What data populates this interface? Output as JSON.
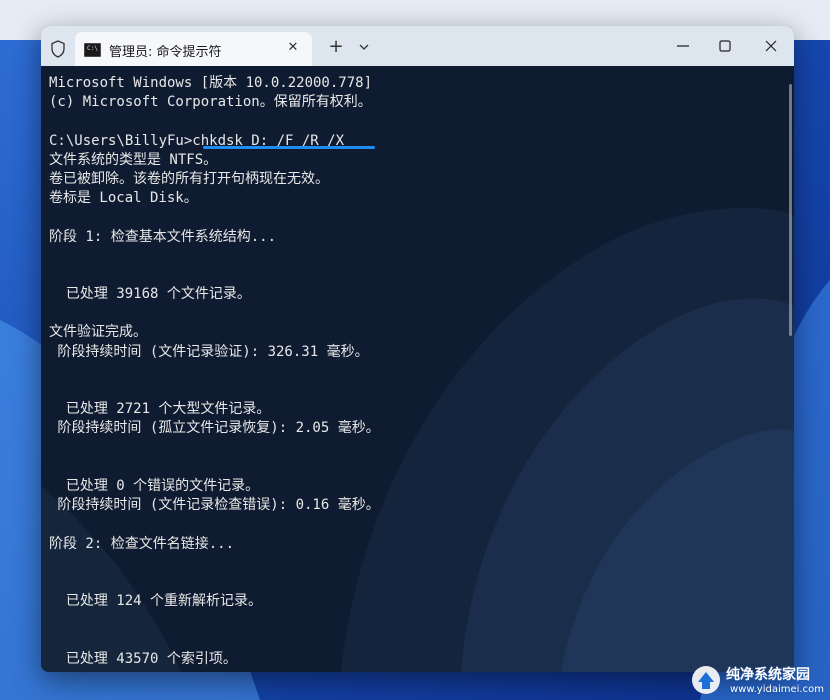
{
  "window": {
    "tab_title": "管理员: 命令提示符",
    "tab_icon_text": "C:\\",
    "tab_close_glyph": "✕",
    "new_tab_glyph": "+"
  },
  "terminal": {
    "lines": [
      "Microsoft Windows [版本 10.0.22000.778]",
      "(c) Microsoft Corporation。保留所有权利。",
      "",
      "C:\\Users\\BillyFu>chkdsk D: /F /R /X",
      "文件系统的类型是 NTFS。",
      "卷已被卸除。该卷的所有打开句柄现在无效。",
      "卷标是 Local Disk。",
      "",
      "阶段 1: 检查基本文件系统结构...",
      "",
      "",
      "  已处理 39168 个文件记录。",
      "",
      "文件验证完成。",
      " 阶段持续时间 (文件记录验证): 326.31 毫秒。",
      "",
      "",
      "  已处理 2721 个大型文件记录。",
      " 阶段持续时间 (孤立文件记录恢复): 2.05 毫秒。",
      "",
      "",
      "  已处理 0 个错误的文件记录。",
      " 阶段持续时间 (文件记录检查错误): 0.16 毫秒。",
      "",
      "阶段 2: 检查文件名链接...",
      "",
      "",
      "  已处理 124 个重新解析记录。",
      "",
      "",
      "  已处理 43570 个索引项。"
    ]
  },
  "watermark": {
    "title": "纯净系统家园",
    "url": "www.yidaimei.com"
  },
  "colors": {
    "accent_underline": "#1e8cf0",
    "titlebar": "#dde5ef",
    "terminal_text": "#e8e8e8"
  }
}
